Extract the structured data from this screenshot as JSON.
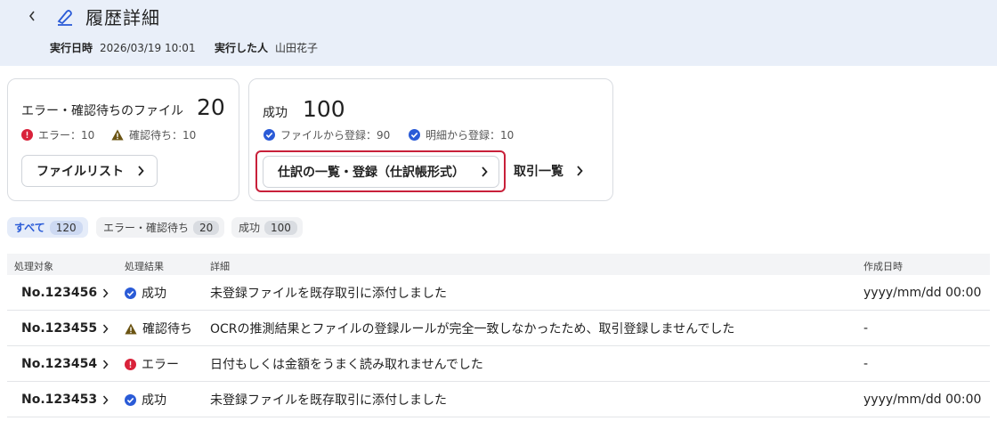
{
  "header": {
    "back_label": "‹",
    "title": "履歴詳細",
    "executed_at_label": "実行日時",
    "executed_at": "2026/03/19 10:01",
    "executor_label": "実行した人",
    "executor": "山田花子"
  },
  "error_card": {
    "label": "エラー・確認待ちのファイル",
    "value": "20",
    "error_text": "エラー：10",
    "pending_text": "確認待ち：10",
    "button_label": "ファイルリスト"
  },
  "success_card": {
    "label": "成功",
    "value": "100",
    "from_file_text": "ファイルから登録：90",
    "from_detail_text": "明細から登録：10",
    "journal_button_label": "仕訳の一覧・登録（仕訳帳形式）",
    "transactions_link_label": "取引一覧"
  },
  "filters": [
    {
      "label": "すべて",
      "count": "120"
    },
    {
      "label": "エラー・確認待ち",
      "count": "20"
    },
    {
      "label": "成功",
      "count": "100"
    }
  ],
  "table": {
    "headers": [
      "処理対象",
      "処理結果",
      "詳細",
      "作成日時"
    ],
    "rows": [
      {
        "target": "No.123456",
        "status": "成功",
        "status_icon": "check-circle-icon",
        "detail": "未登録ファイルを既存取引に添付しました",
        "created": "yyyy/mm/dd 00:00"
      },
      {
        "target": "No.123455",
        "status": "確認待ち",
        "status_icon": "warning-triangle-icon",
        "detail": "OCRの推測結果とファイルの登録ルールが完全一致しなかったため、取引登録しませんでした",
        "created": "-"
      },
      {
        "target": "No.123454",
        "status": "エラー",
        "status_icon": "error-circle-icon",
        "detail": "日付もしくは金額をうまく読み取れませんでした",
        "created": "-"
      },
      {
        "target": "No.123453",
        "status": "成功",
        "status_icon": "check-circle-icon",
        "detail": "未登録ファイルを既存取引に添付しました",
        "created": "yyyy/mm/dd 00:00"
      }
    ]
  },
  "colors": {
    "header_bg": "#e9eff9",
    "success_blue": "#2a5bd7",
    "error_red": "#d9223a",
    "warning_brown": "#6b5413",
    "highlight": "#c8203a"
  }
}
